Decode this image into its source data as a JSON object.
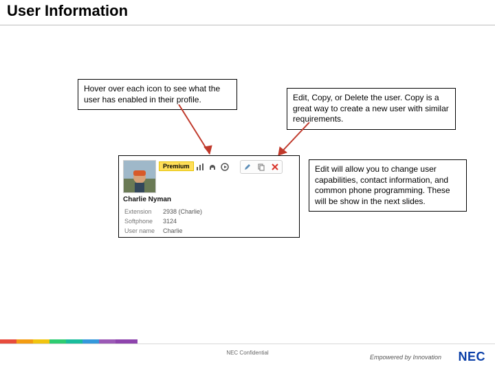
{
  "title": "User Information",
  "callouts": {
    "hover": "Hover over each icon to see what the user has enabled in their profile.",
    "actions": "Edit, Copy, or Delete the user. Copy is a great way to create a new user with similar requirements.",
    "edit": "Edit will allow you to change user capabilities, contact information, and common phone programming. These will be show in the next slides."
  },
  "card": {
    "badge": "Premium",
    "name": "Charlie Nyman",
    "rows": {
      "extension_label": "Extension",
      "extension_value": "2938 (Charlie)",
      "softphone_label": "Softphone",
      "softphone_value": "3124",
      "username_label": "User name",
      "username_value": "Charlie"
    }
  },
  "footer": {
    "confidential": "NEC Confidential",
    "tagline": "Empowered by Innovation",
    "logo": "NEC"
  }
}
